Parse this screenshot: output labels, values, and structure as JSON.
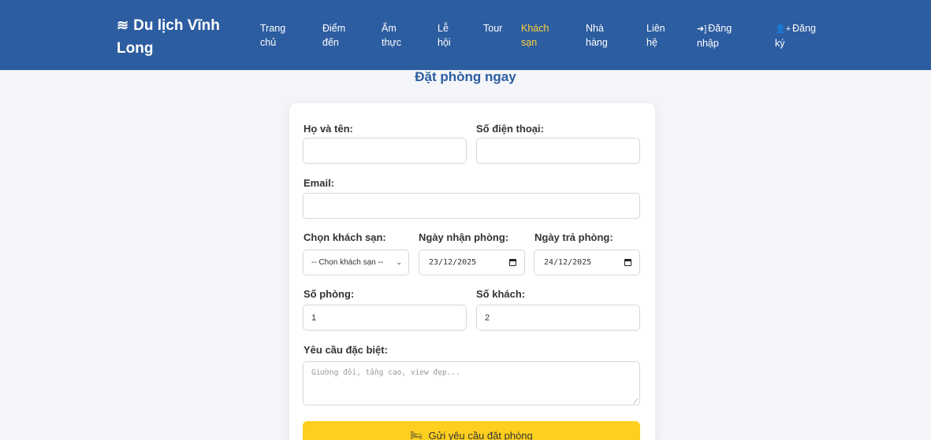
{
  "nav": {
    "brand": {
      "icon": "water-icon",
      "line1": "Du lịch Vĩnh",
      "line2": "Long"
    },
    "items": [
      {
        "line1": "Trang",
        "line2": "chủ"
      },
      {
        "line1": "Điểm",
        "line2": "đến"
      },
      {
        "line1": "Ẩm",
        "line2": "thực"
      },
      {
        "line1": "Lễ",
        "line2": "hội"
      },
      {
        "line1": "Tour",
        "line2": ""
      },
      {
        "line1": "Khách",
        "line2": "sạn"
      },
      {
        "line1": "Nhà",
        "line2": "hàng"
      },
      {
        "line1": "Liên",
        "line2": "hệ"
      },
      {
        "icon": "sign-in-icon",
        "line1": "Đăng",
        "line2": "nhập"
      },
      {
        "icon": "user-plus-icon",
        "line1": "Đăng",
        "line2": "ký"
      }
    ],
    "active_index": 5,
    "colors": {
      "background": "#2d5da1",
      "active": "#ffcf3a"
    }
  },
  "page": {
    "title": "Đặt phòng ngay"
  },
  "form": {
    "fullname": {
      "label": "Họ và tên:",
      "value": ""
    },
    "phone": {
      "label": "Số điện thoại:",
      "value": ""
    },
    "email": {
      "label": "Email:",
      "value": ""
    },
    "hotel": {
      "label": "Chọn khách sạn:",
      "selected": "-- Chọn khách sạn --"
    },
    "checkin": {
      "label": "Ngày nhận phòng:",
      "value": "23/12/2025"
    },
    "checkout": {
      "label": "Ngày trả phòng:",
      "value": "24/12/2025"
    },
    "rooms": {
      "label": "Số phòng:",
      "value": "1"
    },
    "guests": {
      "label": "Số khách:",
      "value": "2"
    },
    "requests": {
      "label": "Yêu cầu đặc biệt:",
      "placeholder": "Giường đôi, tầng cao, view đẹp..."
    },
    "submit": {
      "icon": "bed-icon",
      "label": "Gửi yêu cầu đặt phòng",
      "color": "#ffcf1f"
    }
  }
}
